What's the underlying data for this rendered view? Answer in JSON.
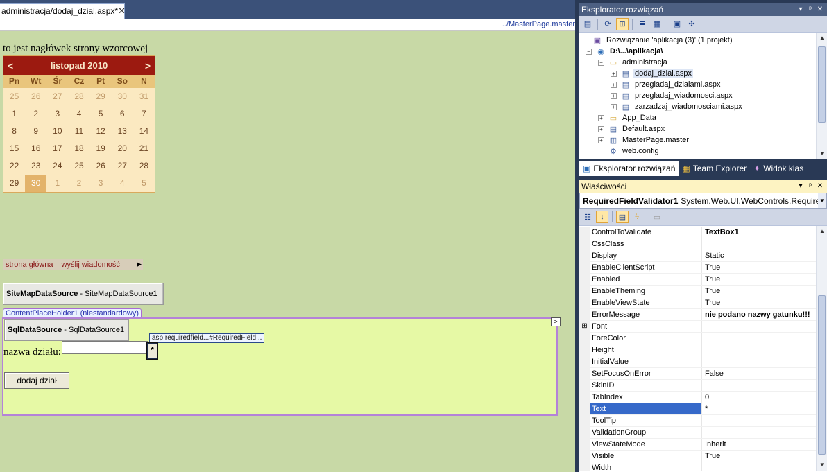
{
  "editor": {
    "tab_title": "administracja/dodaj_dzial.aspx*",
    "tab_close": "✕",
    "master_link": "../MasterPage.master"
  },
  "design": {
    "master_header": "to jest nagłówek strony wzorcowej",
    "calendar": {
      "prev": "<",
      "next": ">",
      "title": "listopad 2010",
      "day_names": [
        "Pn",
        "Wt",
        "Śr",
        "Cz",
        "Pt",
        "So",
        "N"
      ],
      "days": [
        [
          "25",
          "26",
          "27",
          "28",
          "29",
          "30",
          "31"
        ],
        [
          "1",
          "2",
          "3",
          "4",
          "5",
          "6",
          "7"
        ],
        [
          "8",
          "9",
          "10",
          "11",
          "12",
          "13",
          "14"
        ],
        [
          "15",
          "16",
          "17",
          "18",
          "19",
          "20",
          "21"
        ],
        [
          "22",
          "23",
          "24",
          "25",
          "26",
          "27",
          "28"
        ],
        [
          "29",
          "30",
          "1",
          "2",
          "3",
          "4",
          "5"
        ]
      ],
      "selected_day": "30"
    },
    "menu": {
      "item_home": "strona główna",
      "item_send": "wyślij wiadomość",
      "arrow": "▶"
    },
    "sitemap_ds": {
      "type": "SiteMapDataSource",
      "name": " - SiteMapDataSource1"
    },
    "content_placeholder_label": "ContentPlaceHolder1 (niestandardowy)",
    "cph_arrow": ">",
    "sql_ds": {
      "type": "SqlDataSource",
      "name": " - SqlDataSource1"
    },
    "field_label": "nazwa działu:",
    "name_input_value": "",
    "validator_tag": "asp:requiredfield...#RequiredField...",
    "validator_text": "*",
    "submit_label": "dodaj dział"
  },
  "solution_explorer": {
    "title": "Eksplorator rozwiązań",
    "title_buttons": [
      "▾",
      "ᵖ",
      "✕"
    ],
    "toolbar_icons": [
      "properties-icon",
      "refresh-icon",
      "nest-icon",
      "view-code-icon",
      "view-designer-icon",
      "copy-website-icon",
      "aspnet-config-icon"
    ],
    "tree": {
      "solution": "Rozwiązanie 'aplikacja (3)' (1 projekt)",
      "project": "D:\\...\\aplikacja\\",
      "folder_admin": "administracja",
      "file_dodaj": "dodaj_dzial.aspx",
      "file_przegladaj_dzialami": "przegladaj_dzialami.aspx",
      "file_przegladaj_wiadomosci": "przegladaj_wiadomosci.aspx",
      "file_zarzadzaj": "zarzadzaj_wiadomosciami.aspx",
      "folder_app_data": "App_Data",
      "file_default": "Default.aspx",
      "file_master": "MasterPage.master",
      "file_webconfig": "web.config"
    },
    "tabs": {
      "solution": "Eksplorator rozwiązań",
      "team": "Team Explorer",
      "classes": "Widok klas"
    }
  },
  "properties": {
    "title": "Właściwości",
    "object_name": "RequiredFieldValidator1",
    "object_type": "System.Web.UI.WebControls.RequiredFi",
    "rows": [
      {
        "name": "ControlToValidate",
        "value": "TextBox1",
        "bold": true
      },
      {
        "name": "CssClass",
        "value": ""
      },
      {
        "name": "Display",
        "value": "Static"
      },
      {
        "name": "EnableClientScript",
        "value": "True"
      },
      {
        "name": "Enabled",
        "value": "True"
      },
      {
        "name": "EnableTheming",
        "value": "True"
      },
      {
        "name": "EnableViewState",
        "value": "True"
      },
      {
        "name": "ErrorMessage",
        "value": "nie podano nazwy gatunku!!!",
        "bold": true
      },
      {
        "name": "Font",
        "value": "",
        "expandable": true
      },
      {
        "name": "ForeColor",
        "value": ""
      },
      {
        "name": "Height",
        "value": ""
      },
      {
        "name": "InitialValue",
        "value": ""
      },
      {
        "name": "SetFocusOnError",
        "value": "False"
      },
      {
        "name": "SkinID",
        "value": ""
      },
      {
        "name": "TabIndex",
        "value": "0"
      },
      {
        "name": "Text",
        "value": "*",
        "selected": true
      },
      {
        "name": "ToolTip",
        "value": ""
      },
      {
        "name": "ValidationGroup",
        "value": ""
      },
      {
        "name": "ViewStateMode",
        "value": "Inherit"
      },
      {
        "name": "Visible",
        "value": "True"
      },
      {
        "name": "Width",
        "value": ""
      }
    ]
  }
}
